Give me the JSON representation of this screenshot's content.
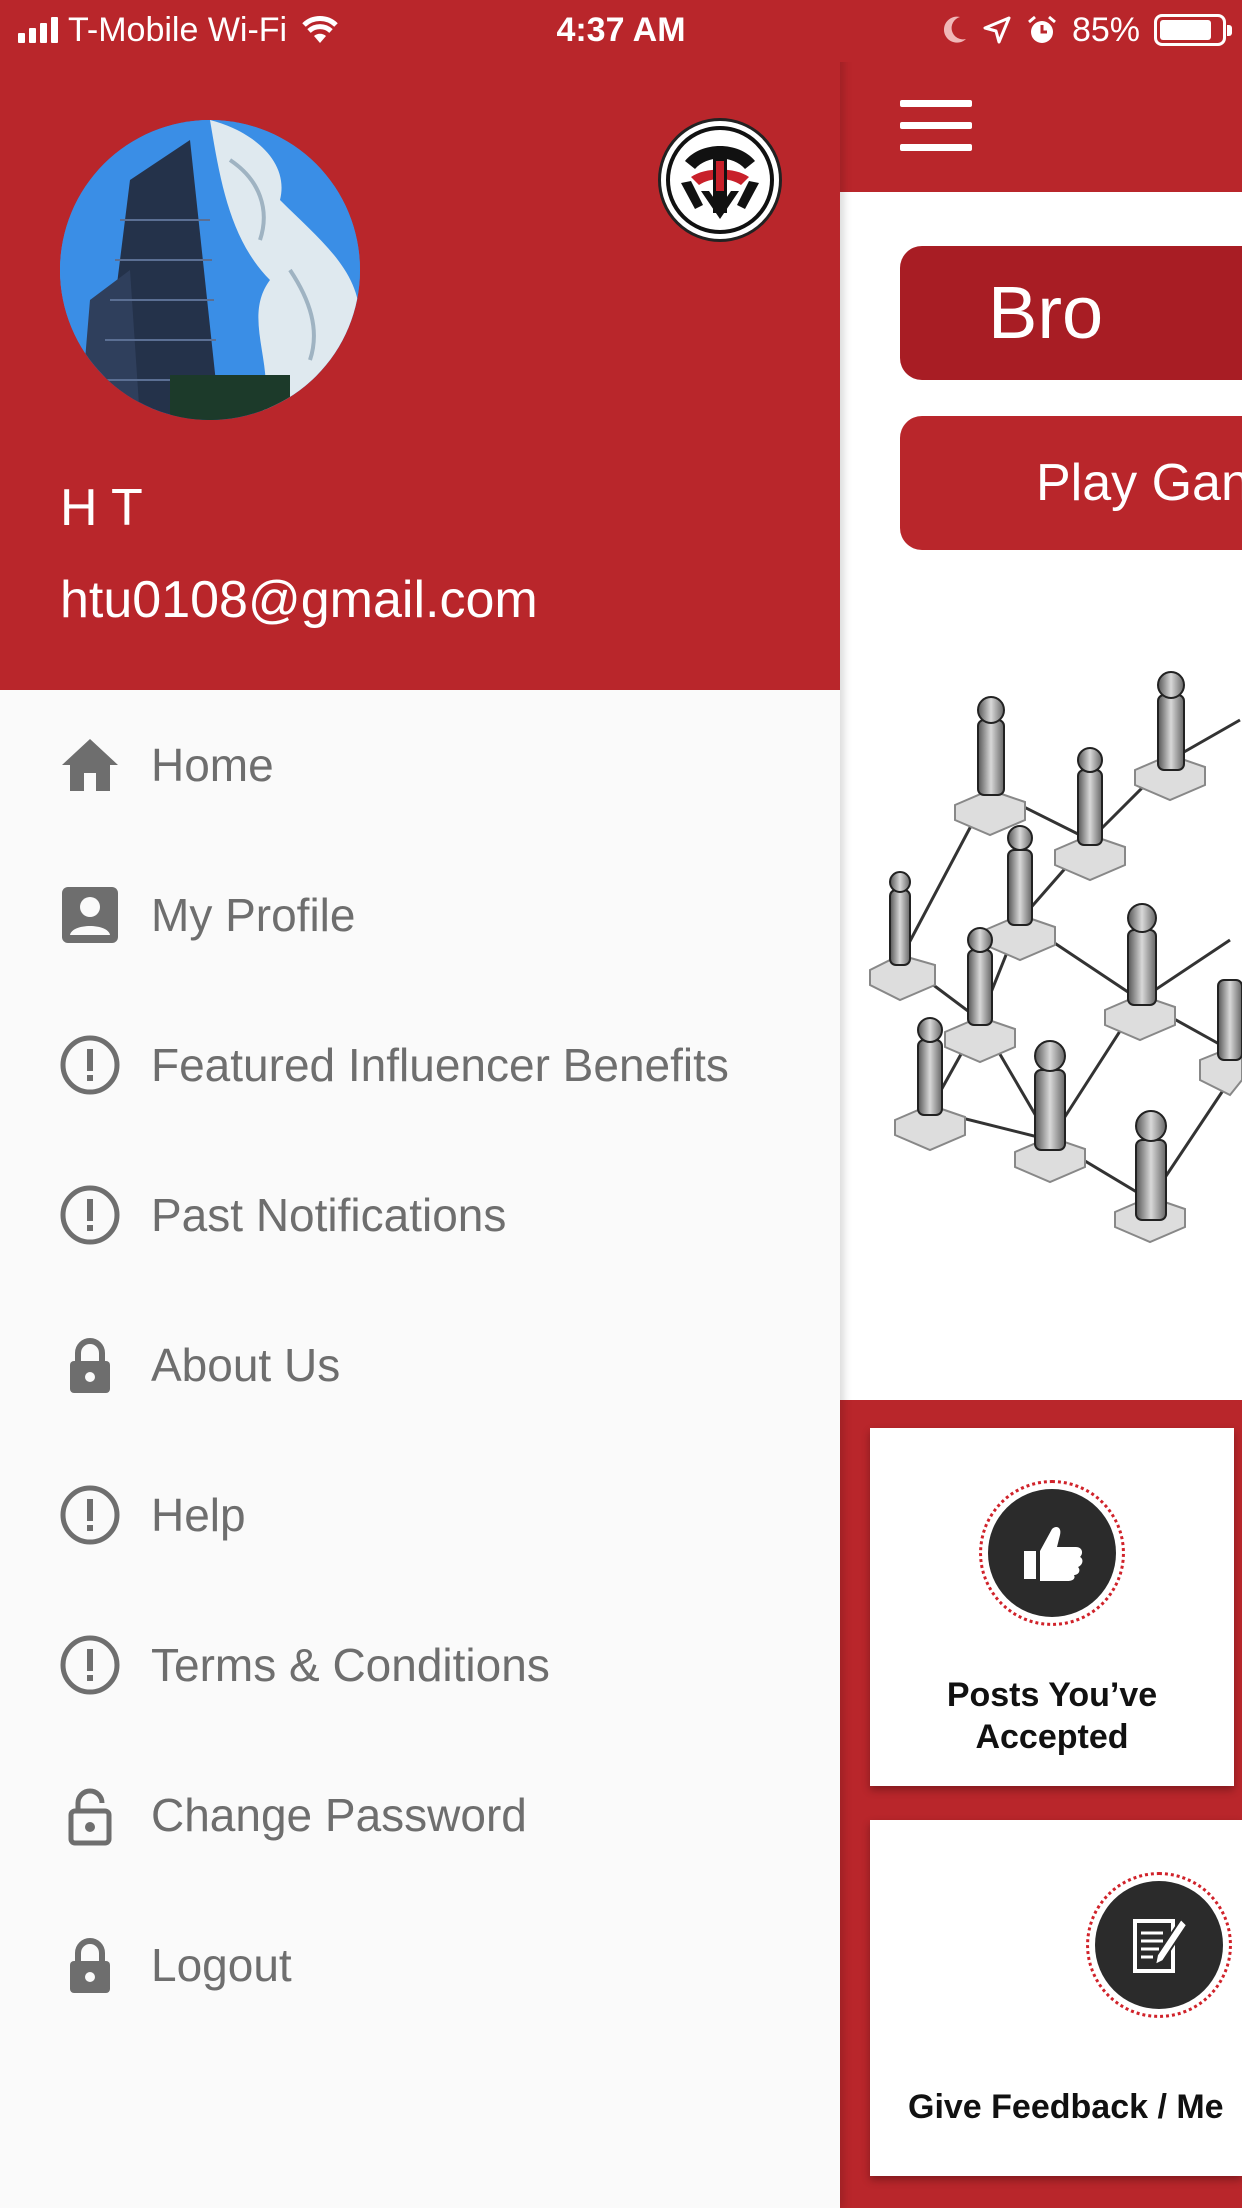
{
  "status_bar": {
    "carrier": "T-Mobile Wi-Fi",
    "time": "4:37 AM",
    "battery_percent": "85%",
    "battery_level": 0.85,
    "icons": [
      "signal-icon",
      "wifi-icon",
      "moon-icon",
      "location-icon",
      "alarm-icon",
      "battery-icon"
    ]
  },
  "drawer": {
    "user": {
      "name": "H T",
      "email": "htu0108@gmail.com"
    },
    "menu": [
      {
        "label": "Home",
        "icon": "home-icon"
      },
      {
        "label": "My Profile",
        "icon": "profile-icon"
      },
      {
        "label": "Featured Influencer Benefits",
        "icon": "alert-circle-icon"
      },
      {
        "label": "Past Notifications",
        "icon": "alert-circle-icon"
      },
      {
        "label": "About Us",
        "icon": "lock-icon"
      },
      {
        "label": "Help",
        "icon": "alert-circle-icon"
      },
      {
        "label": "Terms & Conditions",
        "icon": "alert-circle-icon"
      },
      {
        "label": "Change Password",
        "icon": "lock-open-icon"
      },
      {
        "label": "Logout",
        "icon": "lock-icon"
      }
    ]
  },
  "main": {
    "primary_button": "Bro",
    "secondary_button": "Play Gan",
    "cards": [
      {
        "label": "Posts You’ve Accepted",
        "icon": "thumbs-up-icon"
      },
      {
        "label": "Give Feedback / Me",
        "icon": "feedback-icon"
      }
    ]
  },
  "colors": {
    "brand_red": "#b9262b",
    "dark_red": "#a81d24",
    "menu_text": "#6e6e6e",
    "drawer_bg": "#fafafa"
  }
}
